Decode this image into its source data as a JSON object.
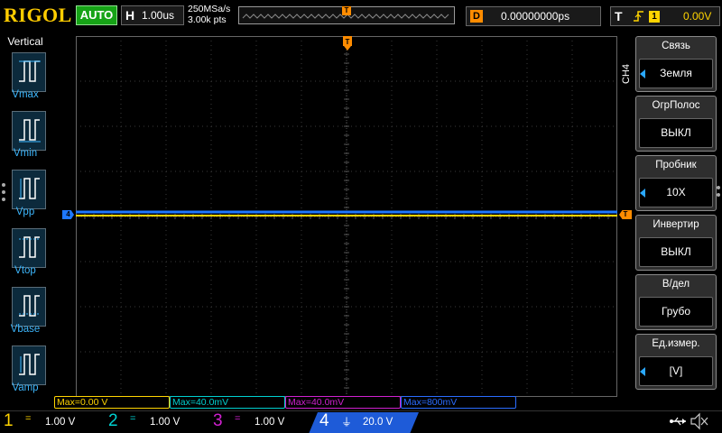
{
  "top": {
    "brand": "RIGOL",
    "run_status": "AUTO",
    "horizontal_label": "H",
    "timebase": "1.00us",
    "sample_rate": "250MSa/s",
    "memory_depth": "3.00k pts",
    "trigger_marker": "T",
    "delay_label": "D",
    "delay_value": "0.00000000ps",
    "trigger_label": "T",
    "trigger_edge_icon": "rising-edge-icon",
    "trigger_source": "1",
    "trigger_level": "0.00V"
  },
  "left_panel": {
    "title": "Vertical",
    "items": [
      {
        "label": "Vmax",
        "icon": "vmax-icon"
      },
      {
        "label": "Vmin",
        "icon": "vmin-icon"
      },
      {
        "label": "Vpp",
        "icon": "vpp-icon"
      },
      {
        "label": "Vtop",
        "icon": "vtop-icon"
      },
      {
        "label": "Vbase",
        "icon": "vbase-icon"
      },
      {
        "label": "Vamp",
        "icon": "vamp-icon"
      }
    ]
  },
  "markers": {
    "channel4": "4",
    "trigger_level": "T",
    "trigger_position": "T"
  },
  "right_menu": {
    "channel_tab": "CH4",
    "items": [
      {
        "title": "Связь",
        "value": "Земля",
        "has_arrow": true
      },
      {
        "title": "ОгрПолос",
        "value": "ВЫКЛ",
        "has_arrow": false
      },
      {
        "title": "Пробник",
        "value": "10X",
        "has_arrow": true
      },
      {
        "title": "Инвертир",
        "value": "ВЫКЛ",
        "has_arrow": false
      },
      {
        "title": "В/дел",
        "value": "Грубо",
        "has_arrow": false
      },
      {
        "title": "Ед.измер.",
        "value": "[V]",
        "has_arrow": true
      }
    ]
  },
  "measurements": [
    {
      "text": "Max=0.00 V",
      "color": "#ffd400"
    },
    {
      "text": "Max=40.0mV",
      "color": "#00d0d0"
    },
    {
      "text": "Max=40.0mV",
      "color": "#d020d0"
    },
    {
      "text": "Max=800mV",
      "color": "#2a6cff"
    }
  ],
  "channels": [
    {
      "num": "1",
      "coupling": "=",
      "scale": "1.00 V",
      "color": "#ffd400"
    },
    {
      "num": "2",
      "coupling": "=",
      "scale": "1.00 V",
      "color": "#00d0d0"
    },
    {
      "num": "3",
      "coupling": "=",
      "scale": "1.00 V",
      "color": "#d020d0"
    },
    {
      "num": "4",
      "coupling": "⏚",
      "scale": "20.0 V",
      "color": "#1e5bd8"
    }
  ],
  "status_icons": {
    "usb": "usb-icon",
    "sound": "mute-icon"
  },
  "colors": {
    "ch1": "#ffd400",
    "ch2": "#00d0d0",
    "ch3": "#d020d0",
    "ch4": "#1e78ff",
    "trigger": "#ff8c00",
    "run": "#16a316"
  }
}
